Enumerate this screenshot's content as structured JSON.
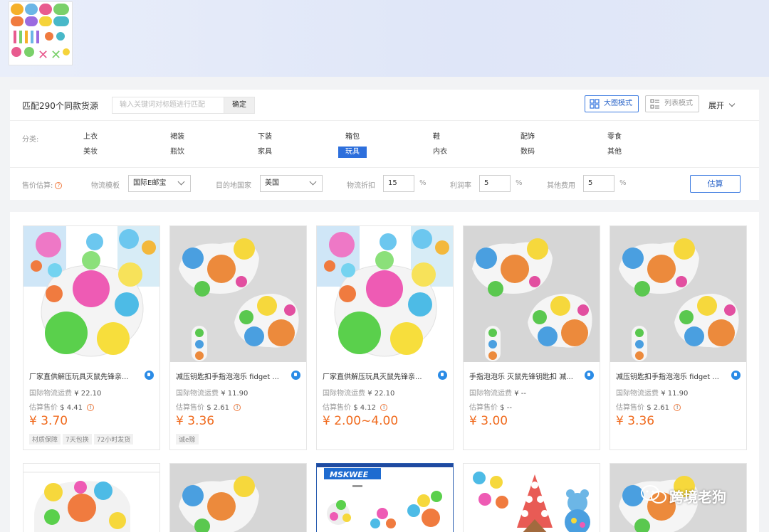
{
  "header": {
    "thumbnail_icon": "product-thumbnail"
  },
  "match": {
    "title": "匹配290个同款货源",
    "keyword_placeholder": "输入关键词对标题进行匹配",
    "confirm_label": "确定",
    "big_mode_label": "大图模式",
    "list_mode_label": "列表模式",
    "expand_label": "展开"
  },
  "categories": {
    "label": "分类:",
    "row1": [
      "上衣",
      "裙装",
      "下装",
      "箱包",
      "鞋",
      "配饰",
      "零食"
    ],
    "row2": [
      "美妆",
      "瓶饮",
      "家具",
      "玩具",
      "内衣",
      "数码",
      "其他"
    ],
    "active": "玩具"
  },
  "estimate": {
    "label": "售价估算:",
    "logistics_template_label": "物流模板",
    "logistics_template_value": "国际E邮宝",
    "destination_label": "目的地国家",
    "destination_value": "美国",
    "discount_label": "物流折扣",
    "discount_value": "15",
    "profit_label": "利润率",
    "profit_value": "5",
    "other_label": "其他费用",
    "other_value": "5",
    "pct": "%",
    "button_label": "估算"
  },
  "products": [
    {
      "title": "厂家直供解压玩具灭鼠先锋亲...",
      "ship_label": "国际物流运费",
      "ship_value": "¥ 22.10",
      "est_label": "估算售价",
      "est_value": "$ 4.41",
      "price": "¥ 3.70",
      "tags": [
        "材质保障",
        "7天包换",
        "72小时发货"
      ]
    },
    {
      "title": "减压钥匙扣手指泡泡乐 fidget ...",
      "ship_label": "国际物流运费",
      "ship_value": "¥ 11.90",
      "est_label": "估算售价",
      "est_value": "$ 2.61",
      "price": "¥ 3.36",
      "tags": [
        "诚e赊"
      ]
    },
    {
      "title": "厂家直供解压玩具灭鼠先锋亲...",
      "ship_label": "国际物流运费",
      "ship_value": "¥ 22.10",
      "est_label": "估算售价",
      "est_value": "$ 4.12",
      "price": "¥ 2.00~4.00",
      "tags": []
    },
    {
      "title": "手指泡泡乐 灭鼠先锋钥匙扣 减...",
      "ship_label": "国际物流运费",
      "ship_value": "¥ --",
      "est_label": "估算售价",
      "est_value": "$ --",
      "price": "¥ 3.00",
      "tags": []
    },
    {
      "title": "减压钥匙扣手指泡泡乐 fidget ...",
      "ship_label": "国际物流运费",
      "ship_value": "¥ 11.90",
      "est_label": "估算售价",
      "est_value": "$ 2.61",
      "price": "¥ 3.36",
      "tags": []
    }
  ],
  "second_row": {
    "brand_label": "MSKWEE"
  },
  "watermark": "跨境老狗",
  "colors": {
    "accent": "#2d6fdc",
    "price": "#f06a1d"
  }
}
